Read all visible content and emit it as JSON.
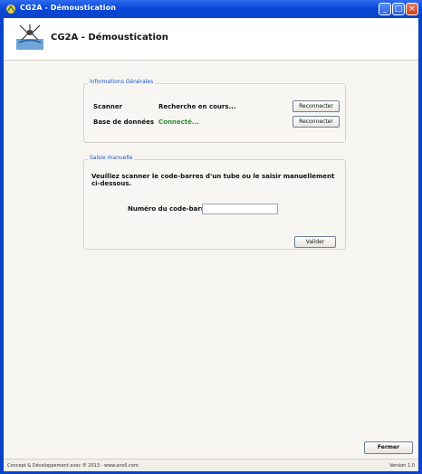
{
  "window": {
    "title": "CG2A - Démoustication",
    "controls": {
      "minimize": "_",
      "maximize": "□",
      "close": "×"
    }
  },
  "header": {
    "title": "CG2A - Démoustication",
    "logo_icon": "mosquito-logo-icon"
  },
  "general_info": {
    "legend": "Informations Générales",
    "rows": [
      {
        "label": "Scanner",
        "status": "Recherche en cours...",
        "button": "Reconnecter",
        "status_color": "#111111"
      },
      {
        "label": "Base de données",
        "status": "Connecté...",
        "button": "Reconnecter",
        "status_color": "#2e8b2e"
      }
    ]
  },
  "manual_entry": {
    "legend": "Saisie manuelle",
    "instruction": "Veuillez scanner le code-barres d'un tube ou le saisir manuellement ci-dessous.",
    "barcode_label": "Numéro du code-barres",
    "barcode_value": "",
    "validate_button": "Valider"
  },
  "footer": {
    "close_button": "Fermer",
    "status_left": "Concept & Développement avec ® 2013 - www.anoll.com",
    "status_right": "Version 1.0"
  }
}
